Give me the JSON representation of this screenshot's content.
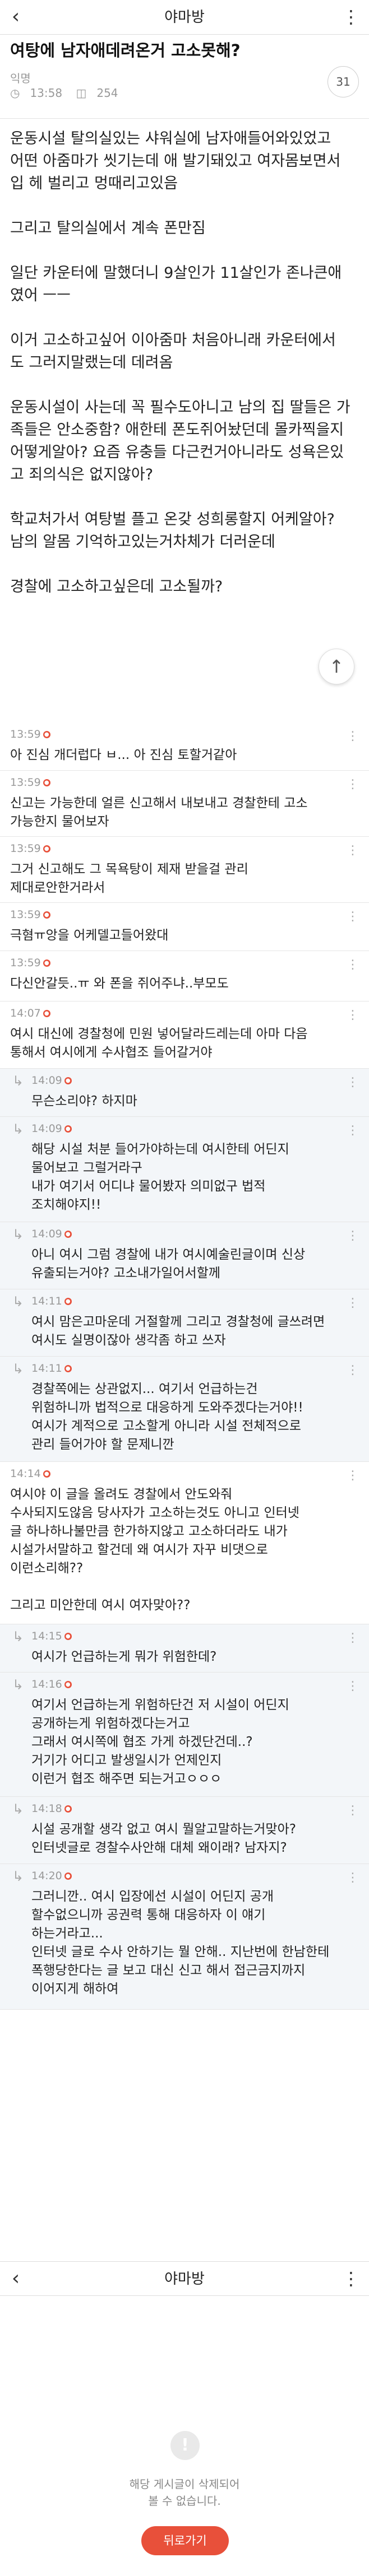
{
  "top_nav": {
    "back": "‹",
    "title": "야마방",
    "more": "⋮"
  },
  "post": {
    "title": "여탕에 남자애데려온거 고소못해?",
    "author": "익명",
    "time": "13:58",
    "views": "254",
    "comment_count": "31",
    "paragraphs": [
      "운동시설 탈의실있는 샤워실에 남자애들어와있었고\n어떤 아줌마가 씻기는데 애 발기돼있고 여자몸보면서\n입 헤 벌리고 멍때리고있음",
      "그리고 탈의실에서 계속 폰만짐",
      "일단 카운터에 말했더니 9살인가 11살인가 존나큰애\n였어 ㅡㅡ",
      "이거 고소하고싶어 이아줌마 처음아니래 카운터에서\n도 그러지말랬는데 데려옴",
      "운동시설이 사는데 꼭 필수도아니고 남의 집 딸들은 가\n족들은 안소중함? 애한테 폰도쥐어놨던데 몰카찍을지\n어떻게알아? 요즘 유충들 다근컨거아니라도 성욕은있\n고 죄의식은 없지않아?",
      "학교처가서 여탕벌 플고 온갖 성희롱할지 어케알아?\n남의 알몸 기억하고있는거차체가 더러운데",
      "경찰에 고소하고싶은데 고소될까?"
    ]
  },
  "comments": [
    {
      "time": "13:59",
      "text": "아 진심 개더럽다 ㅂ... 아 진심 토할거같아",
      "reply": false
    },
    {
      "time": "13:59",
      "text": "신고는 가능한데 얼른 신고해서 내보내고 경찰한테 고소\n가능한지 물어보자",
      "reply": false
    },
    {
      "time": "13:59",
      "text": "그거 신고해도 그 목욕탕이 제재 받을걸 관리\n제대로안한거라서",
      "reply": false
    },
    {
      "time": "13:59",
      "text": "극혐ㅠ앙을 어케델고들어왔대",
      "reply": false
    },
    {
      "time": "13:59",
      "text": "다신안갈듯..ㅠ 와 폰을 쥐어주냐..부모도",
      "reply": false
    },
    {
      "time": "14:07",
      "text": "여시 대신에 경찰청에 민원 넣어달라드레는데 아마 다음\n통해서 여시에게 수사협조 들어갈거야",
      "reply": false
    },
    {
      "time": "14:09",
      "text": "무슨소리야? 하지마",
      "reply": true
    },
    {
      "time": "14:09",
      "text": "해당 시설 처분 들어가야하는데 여시한테 어딘지\n물어보고 그럴거라구\n내가 여기서 어디냐 물어봤자 의미없구 법적\n조치해야지!!",
      "reply": true
    },
    {
      "time": "14:09",
      "text": "아니 여시 그럼 경찰에 내가 여시예술린글이며 신상\n유출되는거야? 고소내가일어서할께",
      "reply": true
    },
    {
      "time": "14:11",
      "text": "여시 맘은고마운데 거절할께 그리고 경찰청에 글쓰려면\n여시도 실명이잖아 생각좀 하고 쓰자",
      "reply": true
    },
    {
      "time": "14:11",
      "text": "경찰쪽에는 상관없지... 여기서 언급하는건\n위험하니까 법적으로 대응하게 도와주겠다는거야!!\n여시가 계적으로 고소할게 아니라 시설 전체적으로\n관리 들어가야 할 문제니깐",
      "reply": true
    },
    {
      "time": "14:14",
      "text": "여시야 이 글을 올려도 경찰에서 안도와줘\n수사되지도않음 당사자가 고소하는것도 아니고 인터넷\n글 하나하나불만큼 한가하지않고 고소하더라도 내가\n시설가서말하고 할건데 왜 여시가 자꾸 비댓으로\n이런소리해??\n\n그리고 미안한데 여시 여자맞아??",
      "reply": false
    },
    {
      "time": "14:15",
      "text": "여시가 언급하는게 뭐가 위험한데?",
      "reply": true
    },
    {
      "time": "14:16",
      "text": "여기서 언급하는게 위험하단건 저 시설이 어딘지\n공개하는게 위험하겠다는거고\n그래서 여시쪽에 협조 가게 하겠단건데..?\n거기가 어디고 발생일시가 언제인지\n이런거 협조 해주면 되는거고ㅇㅇㅇ",
      "reply": true
    },
    {
      "time": "14:18",
      "text": "시설 공개할 생각 없고 여시 뭘알고말하는거맞아?\n인터넷글로 경찰수사안해 대체 왜이래? 남자지?",
      "reply": true
    },
    {
      "time": "14:20",
      "text": "그러니깐.. 여시 입장에선 시설이 어딘지 공개\n할수없으니까 공권력 통해 대응하자 이 얘기\n하는거라고...\n인터넷 글로 수사 안하기는 뭘 안해.. 지난번에 한남한테\n폭행당한다는 글 보고 대신 신고 해서 접근금지까지\n이어지게 해하여",
      "reply": true
    }
  ],
  "bottom_nav": {
    "back": "‹",
    "title": "야마방",
    "more": "⋮"
  },
  "deleted_notice": {
    "icon": "!",
    "message": "해당 게시글이 삭제되어\n볼 수 없습니다.",
    "back_button": "뒤로가기"
  },
  "colors": {
    "accent": "#e8503a",
    "reply_bg": "#f3f6f9",
    "muted": "#999999"
  }
}
